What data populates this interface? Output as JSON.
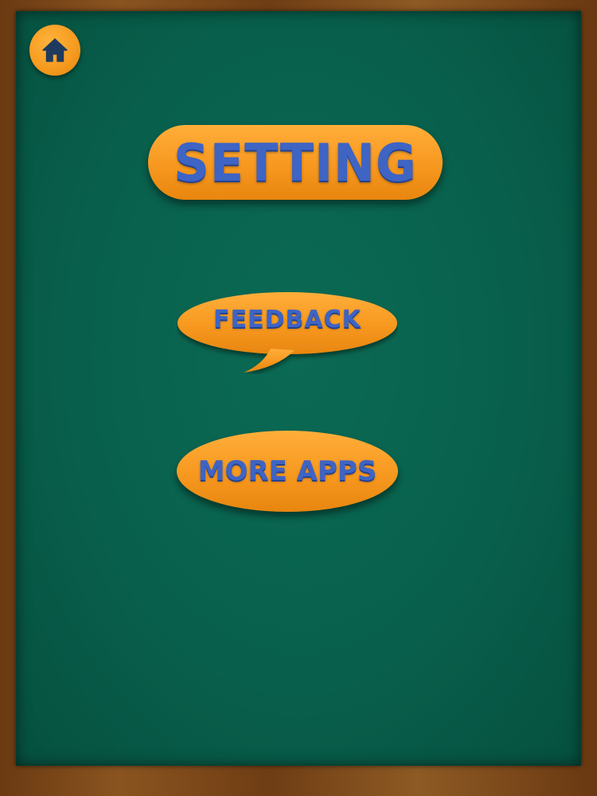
{
  "screen": {
    "title": "SETTING"
  },
  "home_button": {
    "icon": "home-icon"
  },
  "menu": {
    "feedback_label": "FEEDBACK",
    "more_apps_label": "MORE APPS"
  },
  "colors": {
    "accent": "#f7981f",
    "text": "#3e64c4",
    "board": "#08604c",
    "frame": "#6b3a12"
  }
}
